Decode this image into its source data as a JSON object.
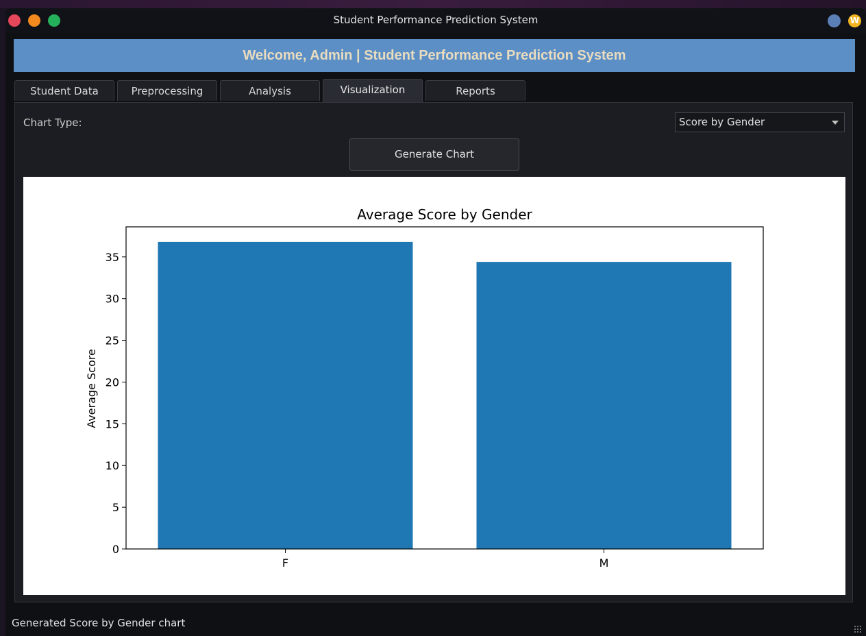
{
  "window": {
    "title": "Student Performance Prediction System"
  },
  "tray": {
    "badge": "W"
  },
  "banner": {
    "text": "Welcome, Admin | Student Performance Prediction System"
  },
  "tabs": [
    {
      "label": "Student Data"
    },
    {
      "label": "Preprocessing"
    },
    {
      "label": "Analysis"
    },
    {
      "label": "Visualization"
    },
    {
      "label": "Reports"
    }
  ],
  "active_tab": "Visualization",
  "controls": {
    "chart_type_label": "Chart Type:",
    "chart_type_value": "Score by Gender",
    "generate_label": "Generate Chart"
  },
  "status": {
    "text": "Generated Score by Gender chart"
  },
  "colors": {
    "bar": "#1f77b4",
    "banner": "#5b8fc6"
  },
  "chart_data": {
    "type": "bar",
    "title": "Average Score by Gender",
    "xlabel": "",
    "ylabel": "Average Score",
    "categories": [
      "F",
      "M"
    ],
    "values": [
      36.8,
      34.4
    ],
    "ylim": [
      0,
      38.6
    ],
    "yticks": [
      0,
      5,
      10,
      15,
      20,
      25,
      30,
      35
    ],
    "grid": false
  }
}
